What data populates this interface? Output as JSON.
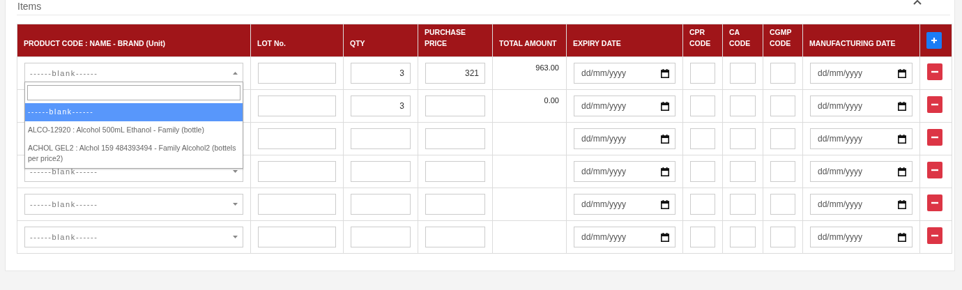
{
  "card": {
    "title": "Items"
  },
  "table": {
    "columns": [
      "PRODUCT CODE : NAME - BRAND (Unit)",
      "LOT No.",
      "QTY",
      "PURCHASE PRICE",
      "TOTAL AMOUNT",
      "EXPIRY DATE",
      "CPR CODE",
      "CA CODE",
      "CGMP CODE",
      "MANUFACTURING DATE"
    ],
    "rows": [
      {
        "product": "------blank------",
        "expanded": true,
        "lot": "",
        "qty": "3",
        "price": "321",
        "total": "963.00",
        "expiry": "dd/mm/yyyy",
        "cpr": "",
        "ca": "",
        "cgmp": "",
        "mfg": "dd/mm/yyyy"
      },
      {
        "lot": "",
        "qty": "3",
        "price": "",
        "total": "0.00",
        "expiry": "dd/mm/yyyy",
        "cpr": "",
        "ca": "",
        "cgmp": "",
        "mfg": "dd/mm/yyyy"
      },
      {
        "lot": "",
        "qty": "",
        "price": "",
        "expiry": "dd/mm/yyyy",
        "cpr": "",
        "ca": "",
        "cgmp": "",
        "mfg": "dd/mm/yyyy"
      },
      {
        "product": "------blank------",
        "expanded": false,
        "lot": "",
        "qty": "",
        "price": "",
        "expiry": "dd/mm/yyyy",
        "cpr": "",
        "ca": "",
        "cgmp": "",
        "mfg": "dd/mm/yyyy"
      },
      {
        "product": "------blank------",
        "expanded": false,
        "lot": "",
        "qty": "",
        "price": "",
        "expiry": "dd/mm/yyyy",
        "cpr": "",
        "ca": "",
        "cgmp": "",
        "mfg": "dd/mm/yyyy"
      },
      {
        "product": "------blank------",
        "expanded": false,
        "lot": "",
        "qty": "",
        "price": "",
        "expiry": "dd/mm/yyyy",
        "cpr": "",
        "ca": "",
        "cgmp": "",
        "mfg": "dd/mm/yyyy"
      }
    ]
  },
  "dropdown": {
    "options": [
      {
        "label": "------blank------",
        "selected": true
      },
      {
        "label": "ALCO-12920 : Alcohol 500mL Ethanol - Family (bottle)",
        "selected": false
      },
      {
        "label": "ACHOL GEL2 : Alchol 159 484393494 - Family Alcohol2 (bottels per price2)",
        "selected": false
      }
    ]
  }
}
